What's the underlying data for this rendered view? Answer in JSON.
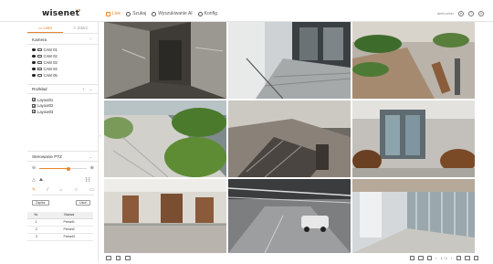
{
  "header": {
    "logo": "wisenet",
    "nav": [
      {
        "label": "Live",
        "icon": "monitor-icon",
        "active": true
      },
      {
        "label": "Szukaj",
        "icon": "search-icon",
        "active": false
      },
      {
        "label": "Wyszukiwanie AI",
        "icon": "ai-search-icon",
        "active": false
      },
      {
        "label": "Konfig",
        "icon": "gear-icon",
        "active": false
      }
    ],
    "right_info": "admin.admin",
    "accent_color": "#e8862a"
  },
  "sidebar": {
    "tabs": [
      {
        "label": "Lista",
        "active": true
      },
      {
        "label": "Zdarz.",
        "active": false
      }
    ],
    "camera_section": {
      "title": "Kamera",
      "items": [
        "CAM 01",
        "CAM 02",
        "CAM 03",
        "CAM 04",
        "CAM 05"
      ]
    },
    "layout_section": {
      "title": "Rozkład",
      "add_label": "+",
      "items": [
        "Layout01",
        "Layout02",
        "Layout03"
      ]
    },
    "ptz": {
      "title": "Sterowanie PTZ",
      "zoom_level": 0.62,
      "save_label": "Zapisz",
      "apply_label": "Usuń",
      "table_headers": [
        "Nr.",
        "Nazwa"
      ],
      "presets": [
        {
          "no": "1",
          "name": "Preset1"
        },
        {
          "no": "2",
          "name": "Preset2"
        },
        {
          "no": "3",
          "name": "Preset3"
        }
      ]
    }
  },
  "pager": "1 / 1",
  "tiles": [
    {
      "name": "tile-elevator-lobby",
      "scene": "elevator"
    },
    {
      "name": "tile-stairwell",
      "scene": "stairs"
    },
    {
      "name": "tile-rooftop-garden",
      "scene": "garden"
    },
    {
      "name": "tile-outdoor-steps",
      "scene": "steps"
    },
    {
      "name": "tile-escalator",
      "scene": "escalator"
    },
    {
      "name": "tile-building-entrance",
      "scene": "entrance"
    },
    {
      "name": "tile-office-hall",
      "scene": "hall"
    },
    {
      "name": "tile-parking-garage",
      "scene": "parking"
    },
    {
      "name": "tile-glass-corridor",
      "scene": "corridor"
    }
  ]
}
